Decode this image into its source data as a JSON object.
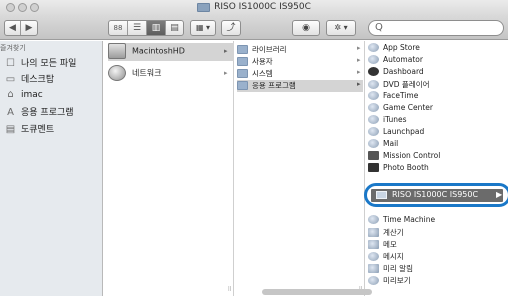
{
  "window": {
    "title": "RISO IS1000C IS950C"
  },
  "toolbar": {
    "back_glyph": "◀",
    "forward_glyph": "▶",
    "view_icon_glyph": "88",
    "view_list_glyph": "☰",
    "view_columns_glyph": "▥",
    "view_coverflow_glyph": "▤",
    "arrange_glyph": "▦ ▾",
    "share_glyph": "⤴",
    "eye_glyph": "◉",
    "action_glyph": "✲ ▾",
    "search_glyph": "Q",
    "search_placeholder": ""
  },
  "sidebar": {
    "header": "즐겨찾기",
    "items": [
      {
        "icon": "all-files-icon",
        "glyph": "☐",
        "label": "나의 모든 파일"
      },
      {
        "icon": "desktop-icon",
        "glyph": "▭",
        "label": "데스크탑"
      },
      {
        "icon": "home-icon",
        "glyph": "⌂",
        "label": "imac"
      },
      {
        "icon": "applications-icon",
        "glyph": "A",
        "label": "응용 프로그램"
      },
      {
        "icon": "documents-icon",
        "glyph": "▤",
        "label": "도큐멘트"
      }
    ]
  },
  "column1": {
    "items": [
      {
        "label": "MacintoshHD",
        "selected": true,
        "chevron": "▸"
      },
      {
        "label": "네트워크",
        "selected": false,
        "chevron": "▸"
      }
    ]
  },
  "column2": {
    "items": [
      {
        "label": "라이브러리",
        "selected": false,
        "chevron": "▸"
      },
      {
        "label": "사용자",
        "selected": false,
        "chevron": "▸"
      },
      {
        "label": "시스템",
        "selected": false,
        "chevron": "▸"
      },
      {
        "label": "응용 프로그램",
        "selected": true,
        "chevron": "▸"
      }
    ]
  },
  "column3": {
    "items": [
      {
        "label": "App Store"
      },
      {
        "label": "Automator"
      },
      {
        "label": "Dashboard"
      },
      {
        "label": "DVD 플레이어"
      },
      {
        "label": "FaceTime"
      },
      {
        "label": "Game Center"
      },
      {
        "label": "iTunes"
      },
      {
        "label": "Launchpad"
      },
      {
        "label": "Mail"
      },
      {
        "label": "Mission Control"
      },
      {
        "label": "Photo Booth"
      }
    ],
    "highlighted": {
      "label": "RISO IS1000C IS950C",
      "chevron": "▶"
    },
    "items_after": [
      {
        "label": "Time Machine"
      },
      {
        "label": "계산기"
      },
      {
        "label": "메모"
      },
      {
        "label": "메시지"
      },
      {
        "label": "미리 알림"
      },
      {
        "label": "미리보기"
      }
    ]
  },
  "colors": {
    "highlight_border": "#1a78c8",
    "selection_bar": "#6b6b6b",
    "sidebar_bg": "#e6eaee"
  }
}
